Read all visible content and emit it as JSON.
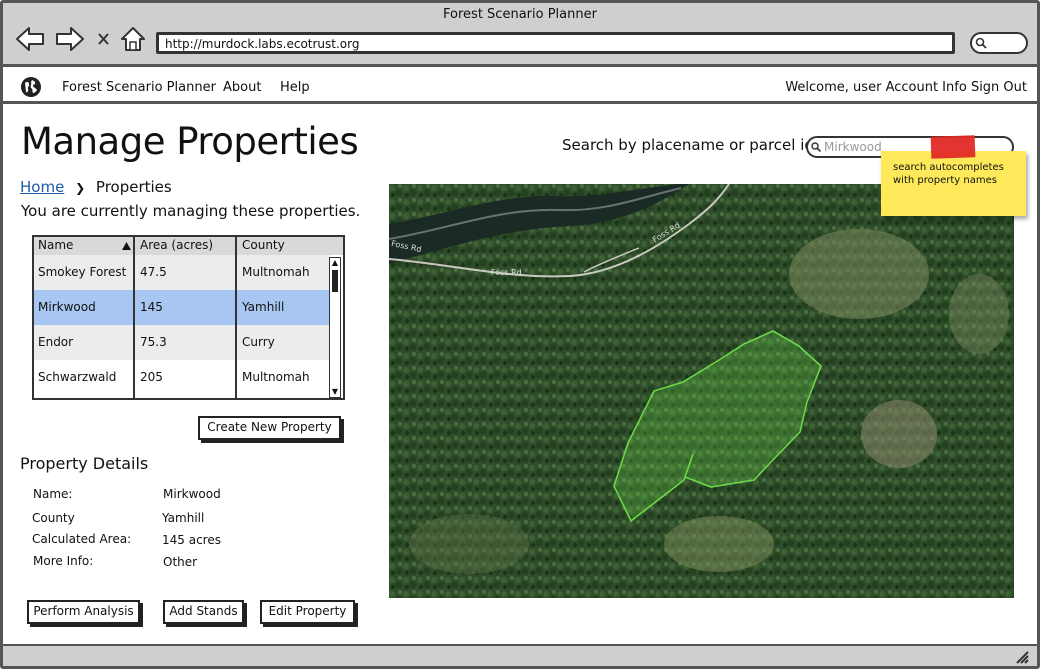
{
  "window": {
    "title": "Forest Scenario Planner",
    "url": "http://murdock.labs.ecotrust.org"
  },
  "appbar": {
    "brand": "Forest Scenario Planner",
    "about": "About",
    "help": "Help",
    "welcome": "Welcome, user",
    "account": "Account Info",
    "signout": "Sign Out"
  },
  "page": {
    "title": "Manage Properties",
    "intro": "You are currently managing these properties."
  },
  "breadcrumb": {
    "home": "Home",
    "current": "Properties"
  },
  "search": {
    "label": "Search by placename or parcel id:",
    "placeholder": "Mirkwood"
  },
  "sticky_note": {
    "text": "search autocompletes with property names"
  },
  "table": {
    "headers": [
      "Name",
      "Area (acres)",
      "County"
    ],
    "sort": "Name ascending",
    "rows": [
      {
        "name": "Smokey Forest",
        "area": "47.5",
        "county": "Multnomah"
      },
      {
        "name": "Mirkwood",
        "area": "145",
        "county": "Yamhill",
        "selected": true
      },
      {
        "name": "Endor",
        "area": "75.3",
        "county": "Curry"
      },
      {
        "name": "Schwarzwald",
        "area": "205",
        "county": "Multnomah"
      }
    ]
  },
  "buttons": {
    "create": "Create New Property",
    "analyze": "Perform Analysis",
    "add_stands": "Add Stands",
    "edit": "Edit Property"
  },
  "details": {
    "title": "Property Details",
    "name_label": "Name:",
    "name_value": "Mirkwood",
    "county_label": "County",
    "county_value": "Yamhill",
    "area_label": "Calculated Area:",
    "area_value": "145 acres",
    "info_label": "More Info:",
    "info_value": "Other"
  },
  "map": {
    "road_label_1": "Foss Rd",
    "road_label_2": "Foss Rd",
    "road_label_3": "Foss Rd"
  },
  "colors": {
    "selected_row": "#a7c7f2",
    "link": "#1b5aa6",
    "parcel": "#6bd84a",
    "sticky": "#fde95a",
    "tape": "#e02a27"
  }
}
